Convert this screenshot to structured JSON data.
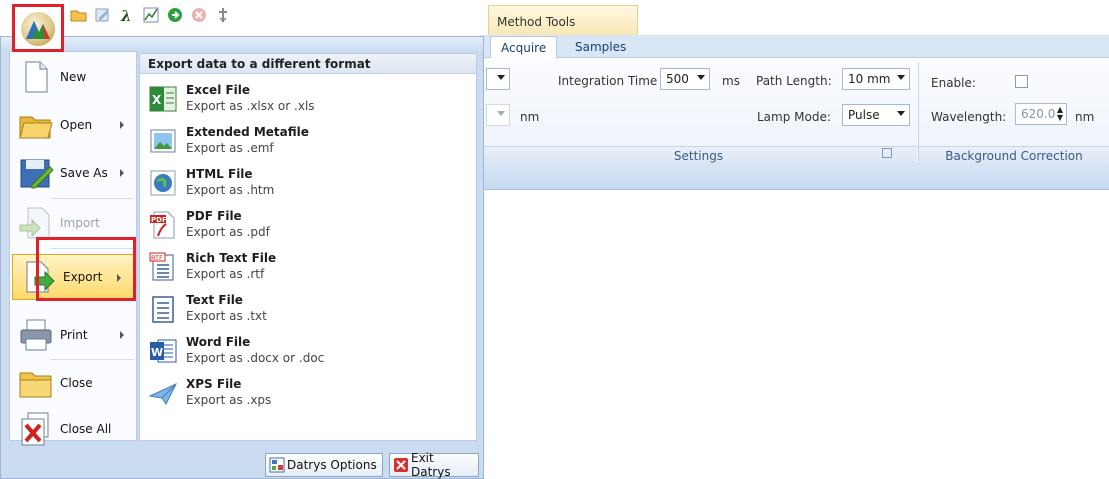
{
  "contextual_tab": {
    "label": "Method Tools"
  },
  "tabs": [
    {
      "label": "Acquire",
      "active": true
    },
    {
      "label": "Samples",
      "active": false
    }
  ],
  "ribbon": {
    "integration_time": {
      "label": "Integration Time",
      "value": "500",
      "unit": "ms"
    },
    "path_length": {
      "label": "Path Length:",
      "value": "10 mm"
    },
    "lamp_mode": {
      "label": "Lamp Mode:",
      "value": "Pulse"
    },
    "nm_unit": "nm",
    "settings_caption": "Settings",
    "background_correction": {
      "caption": "Background Correction",
      "enable_label": "Enable:",
      "wavelength_label": "Wavelength:",
      "wavelength_value": "620.0",
      "wavelength_unit": "nm"
    }
  },
  "app_menu": {
    "commands": [
      {
        "label": "New",
        "icon": "new-document-icon"
      },
      {
        "label": "Open",
        "icon": "open-folder-icon",
        "has_submenu": true
      },
      {
        "label": "Save As",
        "icon": "save-as-icon",
        "has_submenu": true
      },
      {
        "label": "Import",
        "icon": "import-icon",
        "disabled": true
      },
      {
        "label": "Export",
        "icon": "export-icon",
        "has_submenu": true,
        "selected": true
      },
      {
        "label": "Print",
        "icon": "printer-icon",
        "has_submenu": true
      },
      {
        "label": "Close",
        "icon": "close-folder-icon"
      },
      {
        "label": "Close All",
        "icon": "close-all-icon"
      }
    ],
    "submenu": {
      "header": "Export data to a different format",
      "options": [
        {
          "title": "Excel File",
          "desc": "Export as .xlsx or .xls",
          "icon": "excel-icon"
        },
        {
          "title": "Extended Metafile",
          "desc": "Export as .emf",
          "icon": "image-icon"
        },
        {
          "title": "HTML File",
          "desc": "Export as .htm",
          "icon": "globe-icon"
        },
        {
          "title": "PDF File",
          "desc": "Export as .pdf",
          "icon": "pdf-icon"
        },
        {
          "title": "Rich Text File",
          "desc": "Export as .rtf",
          "icon": "rtf-icon"
        },
        {
          "title": "Text File",
          "desc": "Export as .txt",
          "icon": "text-file-icon"
        },
        {
          "title": "Word File",
          "desc": "Export as .docx or .doc",
          "icon": "word-icon"
        },
        {
          "title": "XPS File",
          "desc": "Export as .xps",
          "icon": "xps-icon"
        }
      ]
    },
    "footer": {
      "options_label": "Datrys Options",
      "exit_label": "Exit Datrys"
    }
  },
  "colors": {
    "highlight": "#e0202a",
    "menu_background": "#cbdcf1",
    "selected_item": "#ffd96a",
    "tab_text": "#1c3f73"
  }
}
